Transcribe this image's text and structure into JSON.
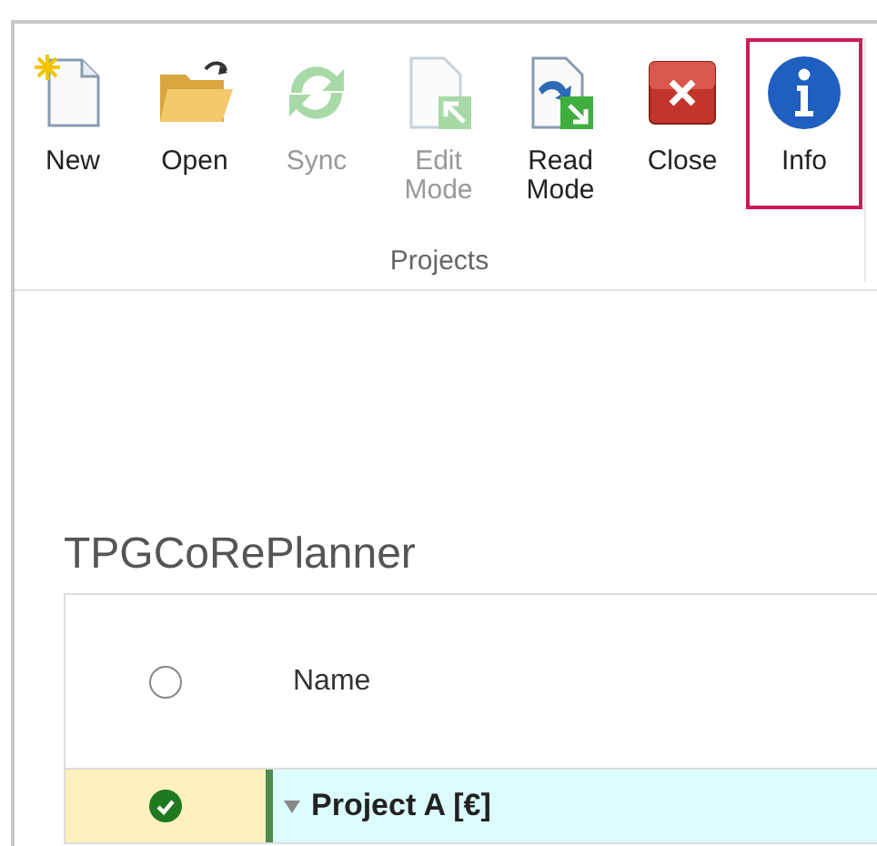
{
  "ribbon": {
    "buttons": [
      {
        "kind": "new",
        "label": "New",
        "disabled": false,
        "highlighted": false
      },
      {
        "kind": "open",
        "label": "Open",
        "disabled": false,
        "highlighted": false
      },
      {
        "kind": "sync",
        "label": "Sync",
        "disabled": true,
        "highlighted": false
      },
      {
        "kind": "edit",
        "label": "Edit Mode",
        "disabled": true,
        "highlighted": false
      },
      {
        "kind": "read",
        "label": "Read Mode",
        "disabled": false,
        "highlighted": false
      },
      {
        "kind": "close",
        "label": "Close",
        "disabled": false,
        "highlighted": false
      },
      {
        "kind": "info",
        "label": "Info",
        "disabled": false,
        "highlighted": true
      }
    ],
    "group_label": "Projects"
  },
  "app_title": "TPGCoRePlanner",
  "table": {
    "select_all": {
      "checked": false
    },
    "columns": [
      {
        "label": "Name"
      }
    ],
    "rows": [
      {
        "name": "Project A [€]",
        "selected": true,
        "expanded": true
      }
    ]
  }
}
